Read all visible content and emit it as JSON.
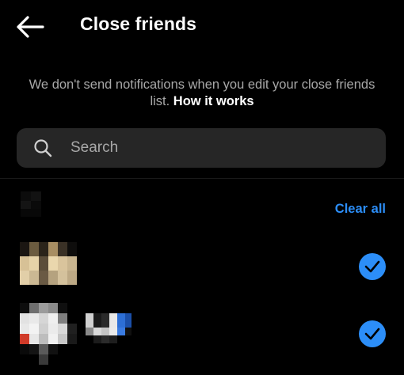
{
  "header": {
    "title": "Close friends"
  },
  "notice": {
    "text": "We don't send notifications when you edit your close friends list.",
    "link": "How it works"
  },
  "search": {
    "placeholder": "Search"
  },
  "list": {
    "clear_all_label": "Clear all",
    "friends": [
      {
        "selected": true
      },
      {
        "selected": true
      }
    ]
  },
  "colors": {
    "accent": "#2c8ef8",
    "background": "#000000",
    "search_bg": "#262626",
    "secondary_text": "#a8a8a8"
  }
}
